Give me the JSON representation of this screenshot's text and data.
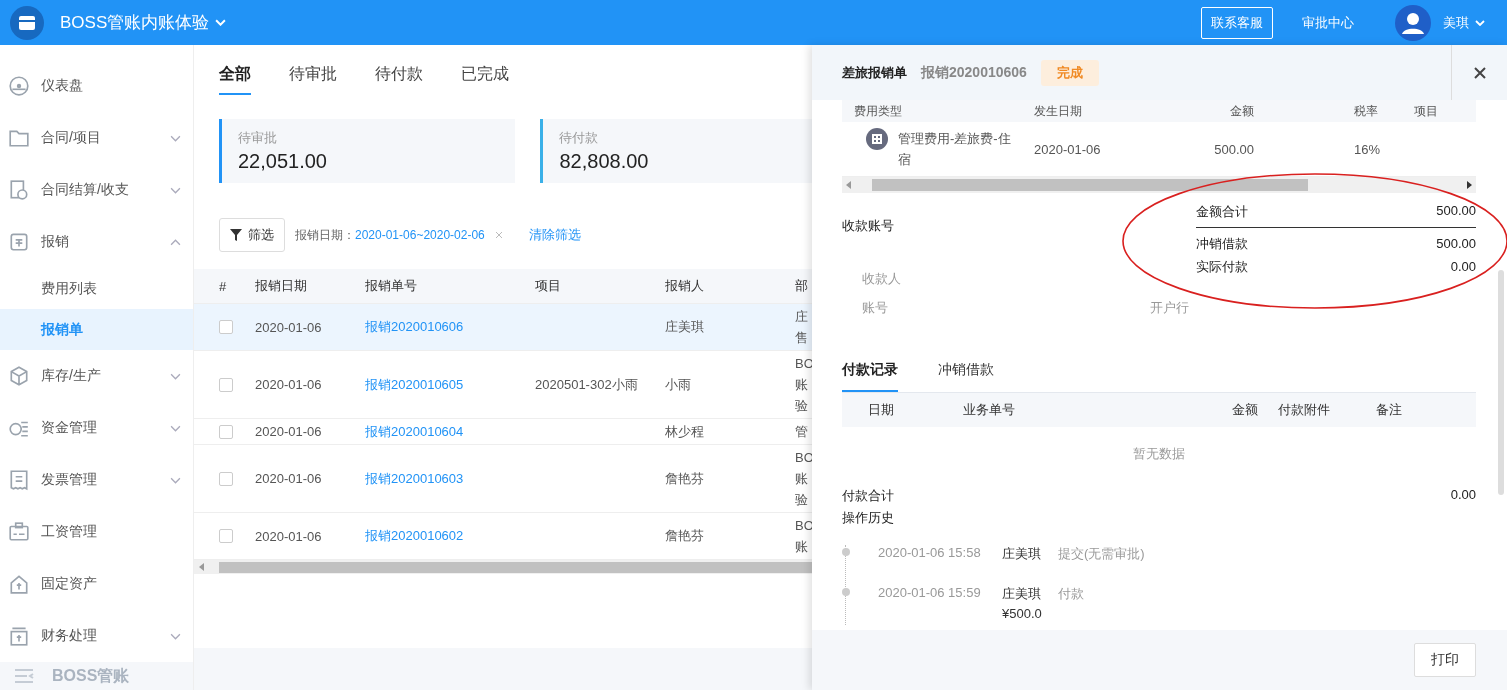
{
  "topbar": {
    "title": "BOSS管账内账体验",
    "buttons": [
      {
        "label": "联系客服",
        "kind": "outline"
      },
      {
        "label": "审批中心",
        "kind": "text"
      }
    ],
    "user": "美琪"
  },
  "sidebar": {
    "items": [
      {
        "label": "仪表盘"
      },
      {
        "label": "合同/项目",
        "expanded": false
      },
      {
        "label": "合同结算/收支",
        "expanded": false
      },
      {
        "label": "报销",
        "expanded": true,
        "children": [
          {
            "label": "费用列表",
            "selected": false
          },
          {
            "label": "报销单",
            "selected": true
          }
        ]
      },
      {
        "label": "库存/生产",
        "expanded": false
      },
      {
        "label": "资金管理",
        "expanded": false
      },
      {
        "label": "发票管理",
        "expanded": false
      },
      {
        "label": "工资管理"
      },
      {
        "label": "固定资产"
      },
      {
        "label": "财务处理",
        "expanded": false
      }
    ],
    "collapse_label": "BOSS管账"
  },
  "tabs": [
    {
      "label": "全部",
      "selected": true
    },
    {
      "label": "待审批",
      "selected": false
    },
    {
      "label": "待付款",
      "selected": false
    },
    {
      "label": "已完成",
      "selected": false
    }
  ],
  "summary_cards": [
    {
      "label": "待审批",
      "value": "22,051.00"
    },
    {
      "label": "待付款",
      "value": "82,808.00"
    }
  ],
  "filter": {
    "button": "筛选",
    "label": "报销日期：",
    "value": "2020-01-06~2020-02-06",
    "clear": "清除筛选"
  },
  "table": {
    "columns": [
      "#",
      "报销日期",
      "报销单号",
      "项目",
      "报销人",
      "部"
    ],
    "rows": [
      {
        "selected": true,
        "checked": false,
        "date": "2020-01-06",
        "number": "报销2020010606",
        "person": "庄美琪",
        "department": [
          "庄",
          "售"
        ]
      },
      {
        "selected": false,
        "checked": false,
        "date": "2020-01-06",
        "number": "报销2020010605",
        "project": "2020501-302小雨",
        "person": "小雨",
        "department": [
          "BO",
          "账",
          "验"
        ]
      },
      {
        "selected": false,
        "checked": false,
        "date": "2020-01-06",
        "number": "报销2020010604",
        "person": "林少程",
        "department": [
          "管"
        ]
      },
      {
        "selected": false,
        "checked": false,
        "date": "2020-01-06",
        "number": "报销2020010603",
        "person": "詹艳芬",
        "department": [
          "BO",
          "账",
          "验"
        ]
      },
      {
        "selected": false,
        "checked": false,
        "date": "2020-01-06",
        "number": "报销2020010602",
        "person": "詹艳芬",
        "department": [
          "BO",
          "账"
        ]
      }
    ]
  },
  "drawer": {
    "type": "差旅报销单",
    "number": "报销2020010606",
    "status": "完成",
    "items": {
      "columns": [
        "费用类型",
        "发生日期",
        "金额",
        "税率",
        "项目"
      ],
      "rows": [
        {
          "type": "管理费用-差旅费-住宿",
          "date": "2020-01-06",
          "amount": "500.00",
          "tax_rate": "16%"
        }
      ]
    },
    "account_title": "收款账号",
    "totals": [
      {
        "label": "金额合计",
        "value": "500.00"
      },
      {
        "label": "冲销借款",
        "value": "500.00"
      },
      {
        "label": "实际付款",
        "value": "0.00"
      }
    ],
    "account_fields": [
      {
        "label": "收款人"
      },
      {
        "label": "账号"
      },
      {
        "label": "开户行"
      }
    ],
    "record_tabs": [
      {
        "label": "付款记录",
        "selected": true
      },
      {
        "label": "冲销借款",
        "selected": false
      }
    ],
    "payment_columns": [
      "日期",
      "业务单号",
      "金额",
      "付款附件",
      "备注"
    ],
    "empty_text": "暂无数据",
    "payment_total": {
      "label": "付款合计",
      "value": "0.00"
    },
    "history_title": "操作历史",
    "history": [
      {
        "time": "2020-01-06 15:58",
        "user": "庄美琪",
        "action": "提交(无需审批)"
      },
      {
        "time": "2020-01-06 15:59",
        "user": "庄美琪",
        "action": "付款",
        "detail": "¥500.0"
      }
    ],
    "print": "打印"
  }
}
